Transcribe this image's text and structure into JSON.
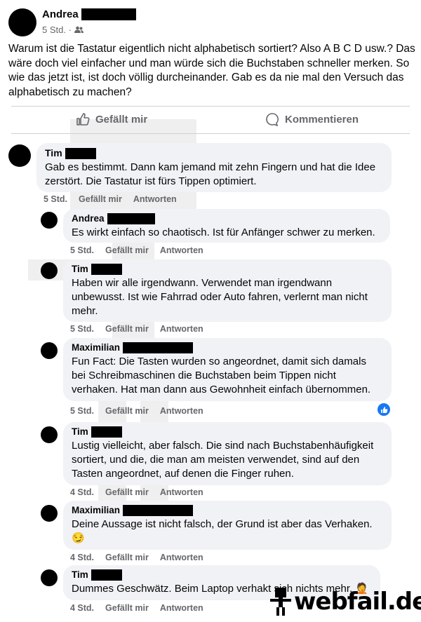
{
  "post": {
    "author": "Andrea",
    "time": "5 Std. ·",
    "text": "Warum ist die Tastatur eigentlich nicht alphabetisch sortiert? Also A B C D usw.? Das wäre doch viel einfacher und man würde sich die Buchstaben schneller merken. So wie das jetzt ist, ist doch völlig durcheinander. Gab es da nie mal den Versuch das alphabetisch zu machen?",
    "like_label": "Gefällt mir",
    "comment_label": "Kommentieren"
  },
  "comments": [
    {
      "author": "Tim",
      "text": "Gab es bestimmt. Dann kam jemand mit zehn Fingern und hat die Idee zerstört. Die Tastatur ist fürs Tippen optimiert.",
      "time": "5 Std.",
      "like": "Gefällt mir",
      "reply": "Antworten"
    },
    {
      "author": "Andrea",
      "text": "Es wirkt einfach so chaotisch. Ist für Anfänger schwer zu merken.",
      "time": "5 Std.",
      "like": "Gefällt mir",
      "reply": "Antworten"
    },
    {
      "author": "Tim",
      "text": "Haben wir alle irgendwann. Verwendet man irgendwann unbewusst. Ist wie Fahrrad oder Auto fahren, verlernt man nicht mehr.",
      "time": "5 Std.",
      "like": "Gefällt mir",
      "reply": "Antworten"
    },
    {
      "author": "Maximilian",
      "text": "Fun Fact: Die Tasten wurden so angeordnet, damit sich damals bei Schreibmaschinen die Buchstaben beim Tippen nicht verhaken. Hat man dann aus Gewohnheit einfach übernommen.",
      "time": "5 Std.",
      "like": "Gefällt mir",
      "reply": "Antworten"
    },
    {
      "author": "Tim",
      "text": "Lustig vielleicht, aber falsch. Die sind nach Buchstabenhäufigkeit sortiert, und die, die man am meisten verwendet, sind auf den Tasten angeordnet, auf denen die Finger ruhen.",
      "time": "4 Std.",
      "like": "Gefällt mir",
      "reply": "Antworten"
    },
    {
      "author": "Maximilian",
      "text": "Deine Aussage ist nicht falsch, der Grund ist aber das Verhaken.",
      "emoji": "😏",
      "time": "4 Std.",
      "like": "Gefällt mir",
      "reply": "Antworten"
    },
    {
      "author": "Tim",
      "text": "Dummes Geschwätz. Beim Laptop verhakt sich nichts mehr.",
      "emoji": "🤦",
      "time": "4 Std.",
      "like": "Gefällt mir",
      "reply": "Antworten"
    }
  ],
  "watermark": "webfail.de",
  "colors": {
    "bubble": "#f0f2f5",
    "meta": "#65676b",
    "like_blue": "#1877f2"
  },
  "icons": {
    "like": "thumbs-up-icon",
    "comment": "speech-bubble-icon",
    "audience": "friends-icon"
  }
}
